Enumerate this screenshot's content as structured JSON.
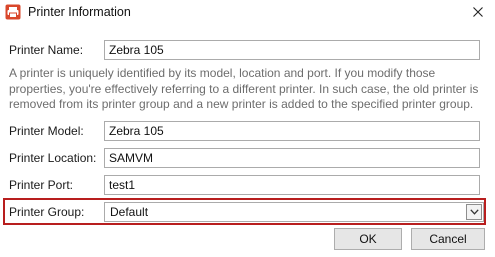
{
  "window": {
    "title": "Printer Information",
    "icon": "printer-app-icon",
    "close_icon": "close-icon"
  },
  "form": {
    "printer_name_label": "Printer Name:",
    "printer_name_value": "Zebra 105",
    "description": "A printer is uniquely identified by its model, location and port. If you modify those properties, you're effectively referring to a different printer. In such case, the old printer is removed from its printer group and a new printer is added to the specified printer group.",
    "printer_model_label": "Printer Model:",
    "printer_model_value": "Zebra 105",
    "printer_location_label": "Printer Location:",
    "printer_location_value": "SAMVM",
    "printer_port_label": "Printer Port:",
    "printer_port_value": "test1",
    "printer_group_label": "Printer Group:",
    "printer_group_value": "Default"
  },
  "buttons": {
    "ok_label": "OK",
    "cancel_label": "Cancel"
  },
  "colors": {
    "highlight": "#b81e1e",
    "icon_accent": "#d9472b"
  }
}
